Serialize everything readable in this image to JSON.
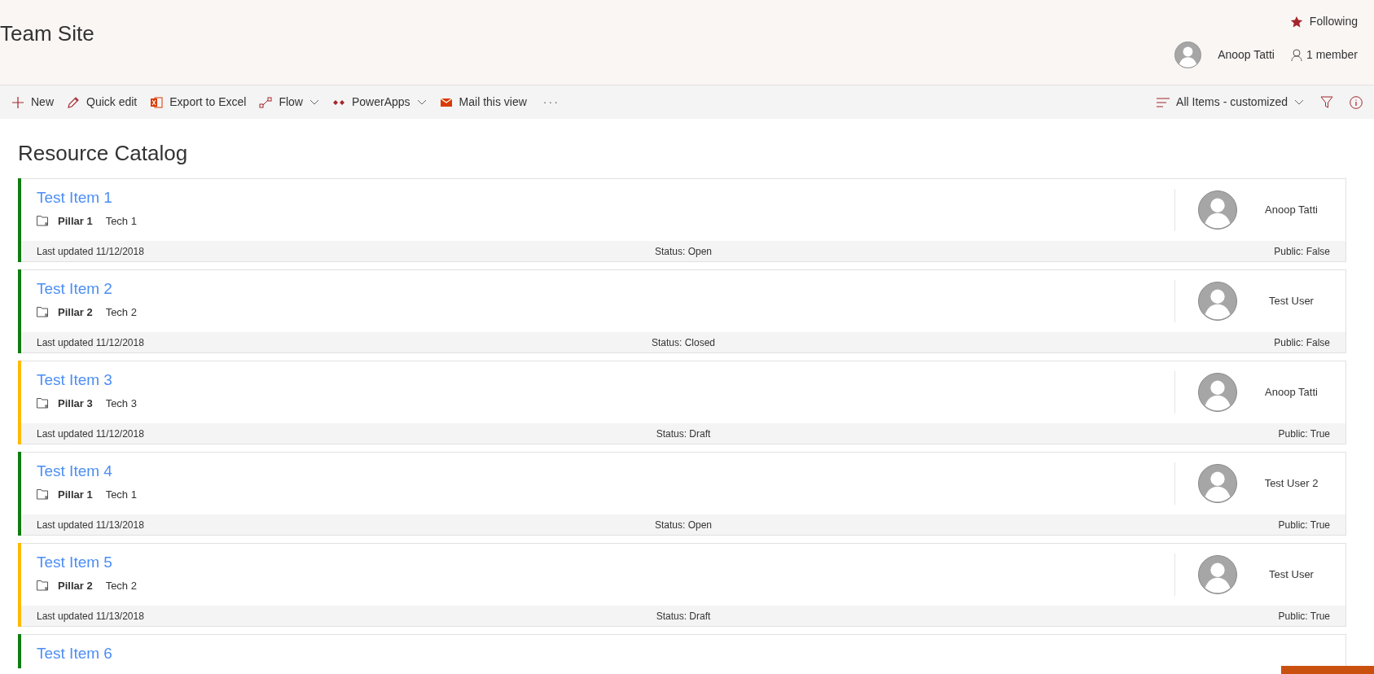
{
  "site": {
    "title": "Team Site",
    "following": "Following",
    "user": "Anoop Tatti",
    "members": "1 member"
  },
  "toolbar": {
    "left": [
      {
        "kind": "new",
        "label": "New",
        "dropdown": false
      },
      {
        "kind": "edit",
        "label": "Quick edit",
        "dropdown": false
      },
      {
        "kind": "excel",
        "label": "Export to Excel",
        "dropdown": false
      },
      {
        "kind": "flow",
        "label": "Flow",
        "dropdown": true
      },
      {
        "kind": "powerapps",
        "label": "PowerApps",
        "dropdown": true
      },
      {
        "kind": "mail",
        "label": "Mail this view",
        "dropdown": false
      },
      {
        "kind": "more",
        "label": "···",
        "dropdown": false
      }
    ],
    "view": "All Items - customized"
  },
  "list_title": "Resource Catalog",
  "items": [
    {
      "title": "Test Item 1",
      "pillar": "Pillar 1",
      "tech": "Tech 1",
      "person": "Anoop Tatti",
      "updated": "Last updated 11/12/2018",
      "status": "Status: Open",
      "public": "Public: False",
      "color": "#107c10"
    },
    {
      "title": "Test Item 2",
      "pillar": "Pillar 2",
      "tech": "Tech 2",
      "person": "Test User",
      "updated": "Last updated 11/12/2018",
      "status": "Status: Closed",
      "public": "Public: False",
      "color": "#107c10"
    },
    {
      "title": "Test Item 3",
      "pillar": "Pillar 3",
      "tech": "Tech 3",
      "person": "Anoop Tatti",
      "updated": "Last updated 11/12/2018",
      "status": "Status: Draft",
      "public": "Public: True",
      "color": "#ffb900"
    },
    {
      "title": "Test Item 4",
      "pillar": "Pillar 1",
      "tech": "Tech 1",
      "person": "Test User 2",
      "updated": "Last updated 11/13/2018",
      "status": "Status: Open",
      "public": "Public: True",
      "color": "#107c10"
    },
    {
      "title": "Test Item 5",
      "pillar": "Pillar 2",
      "tech": "Tech 2",
      "person": "Test User",
      "updated": "Last updated 11/13/2018",
      "status": "Status: Draft",
      "public": "Public: True",
      "color": "#ffb900"
    },
    {
      "title": "Test Item 6",
      "color": "#107c10"
    }
  ]
}
